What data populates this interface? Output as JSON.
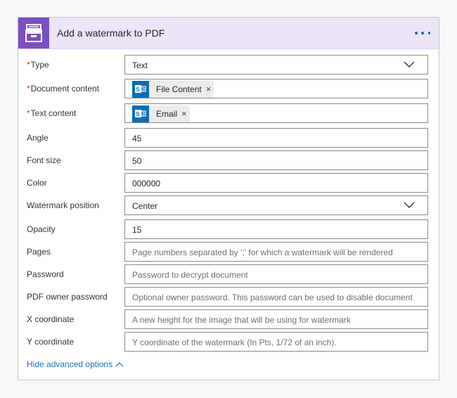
{
  "card": {
    "title": "Add a watermark to PDF",
    "header_color": "#ede4f8",
    "icon_color": "#7b4fc4",
    "icon": "archive-box-icon",
    "more_icon": "ellipsis-icon"
  },
  "fields": {
    "type": {
      "label": "Type",
      "required": "*",
      "value": "Text"
    },
    "document_content": {
      "label": "Document content",
      "required": "*",
      "token": "File Content",
      "token_icon": "sharepoint-file-icon"
    },
    "text_content": {
      "label": "Text content",
      "required": "*",
      "token": "Email",
      "token_icon": "sharepoint-file-icon"
    },
    "angle": {
      "label": "Angle",
      "value": "45"
    },
    "font_size": {
      "label": "Font size",
      "value": "50"
    },
    "color": {
      "label": "Color",
      "value": "000000"
    },
    "watermark_position": {
      "label": "Watermark position",
      "value": "Center"
    },
    "opacity": {
      "label": "Opacity",
      "value": "15"
    },
    "pages": {
      "label": "Pages",
      "placeholder": "Page numbers separated by ';' for which a watermark will be rendered"
    },
    "password": {
      "label": "Password",
      "placeholder": "Password to decrypt document"
    },
    "pdf_owner_password": {
      "label": "PDF owner password",
      "placeholder": "Optional owner password. This password can be used to disable document"
    },
    "x_coordinate": {
      "label": "X coordinate",
      "placeholder": "A new height for the image that will be using for watermark"
    },
    "y_coordinate": {
      "label": "Y coordinate",
      "placeholder": "Y coordinate of the watermark (In Pts, 1/72 of an inch)."
    }
  },
  "footer": {
    "hide_advanced_label": "Hide advanced options",
    "link_color": "#1a6fc2"
  },
  "token_x": "×"
}
